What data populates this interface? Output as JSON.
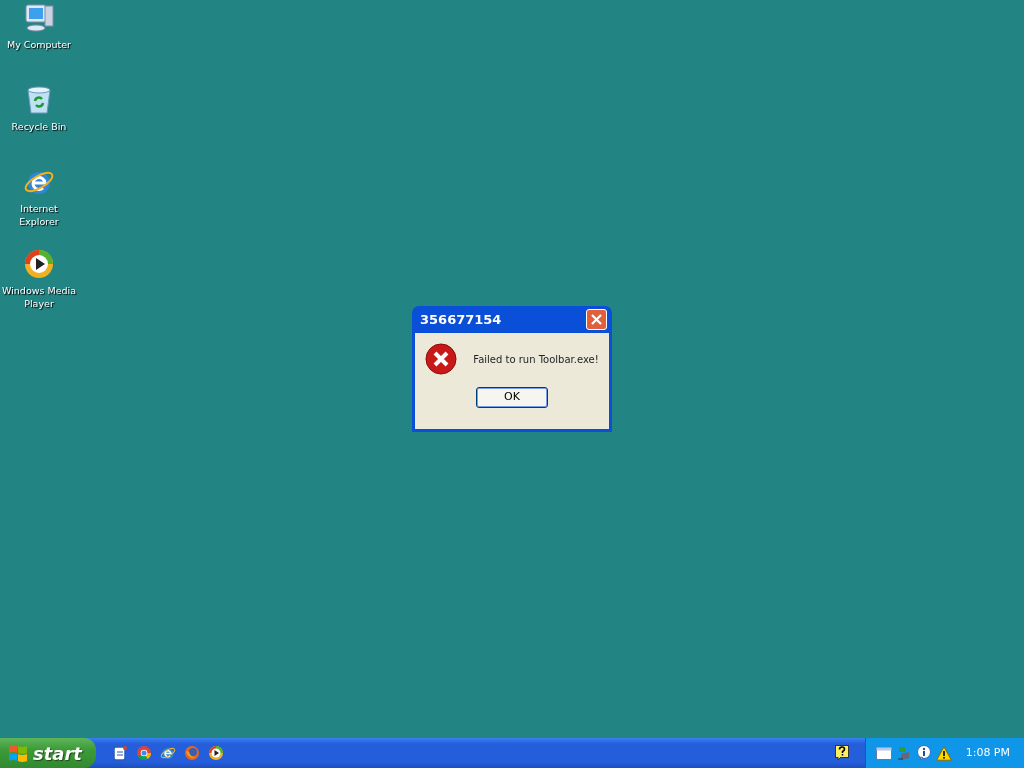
{
  "desktop_icons": [
    {
      "kind": "computer",
      "label": "My Computer"
    },
    {
      "kind": "recycle",
      "label": "Recycle Bin"
    },
    {
      "kind": "ie",
      "label": "Internet Explorer"
    },
    {
      "kind": "media",
      "label": "Windows Media Player"
    }
  ],
  "dialog": {
    "title": "356677154",
    "message": "Failed to run Toolbar.exe!",
    "buttons": [
      "OK"
    ]
  },
  "taskbar": {
    "start_label": "start",
    "quick_launch": [
      {
        "kind": "note"
      },
      {
        "kind": "chrome"
      },
      {
        "kind": "ie"
      },
      {
        "kind": "firefox"
      },
      {
        "kind": "media"
      }
    ],
    "tray_icons": [
      {
        "kind": "window"
      },
      {
        "kind": "network"
      },
      {
        "kind": "info"
      },
      {
        "kind": "warning"
      }
    ],
    "clock": "1:08 PM"
  }
}
